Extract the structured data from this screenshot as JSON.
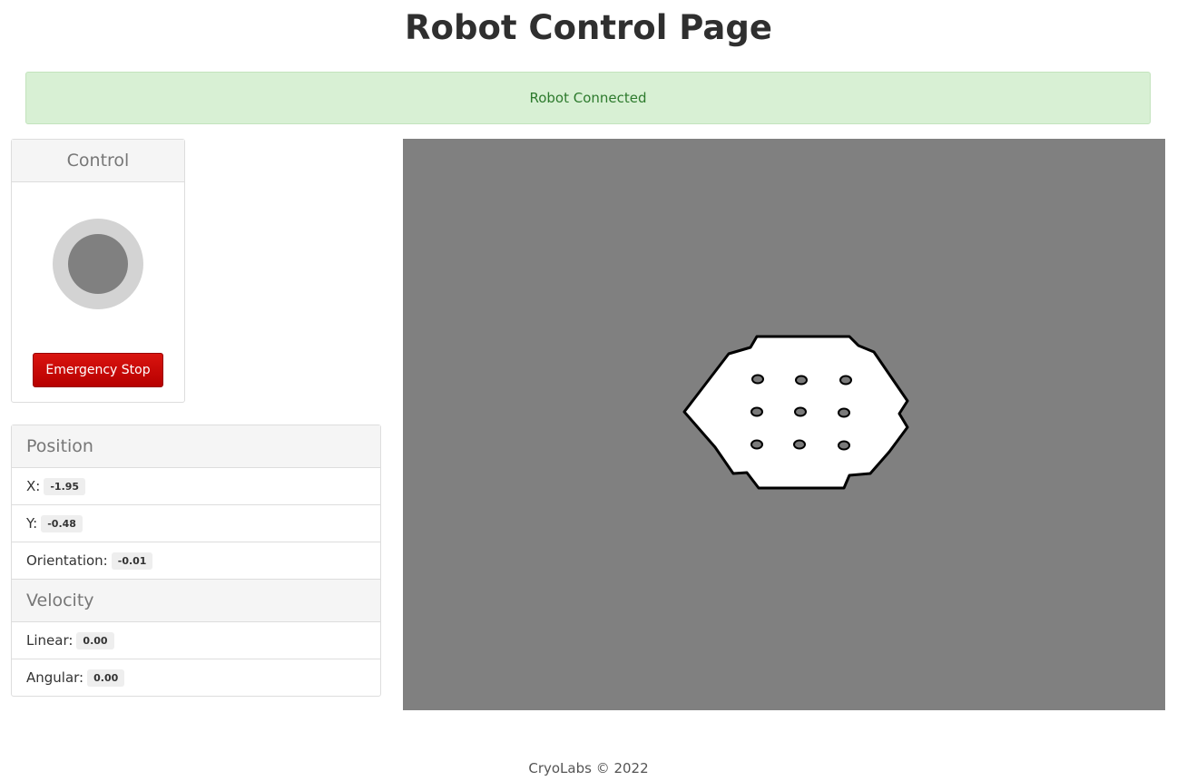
{
  "page": {
    "title": "Robot Control Page"
  },
  "status": {
    "message": "Robot Connected"
  },
  "control": {
    "title": "Control",
    "emergency_stop_label": "Emergency Stop"
  },
  "position": {
    "title": "Position",
    "x_label": "X:",
    "x_value": "-1.95",
    "y_label": "Y:",
    "y_value": "-0.48",
    "orientation_label": "Orientation:",
    "orientation_value": "-0.01"
  },
  "velocity": {
    "title": "Velocity",
    "linear_label": "Linear:",
    "linear_value": "0.00",
    "angular_label": "Angular:",
    "angular_value": "0.00"
  },
  "footer": {
    "text": "CryoLabs © 2022"
  },
  "colors": {
    "alert_bg": "#d8f0d4",
    "alert_text": "#2d7a2d",
    "estop": "#c80000",
    "map_unknown": "#808080",
    "map_free": "#ffffff",
    "map_obstacle": "#000000"
  }
}
